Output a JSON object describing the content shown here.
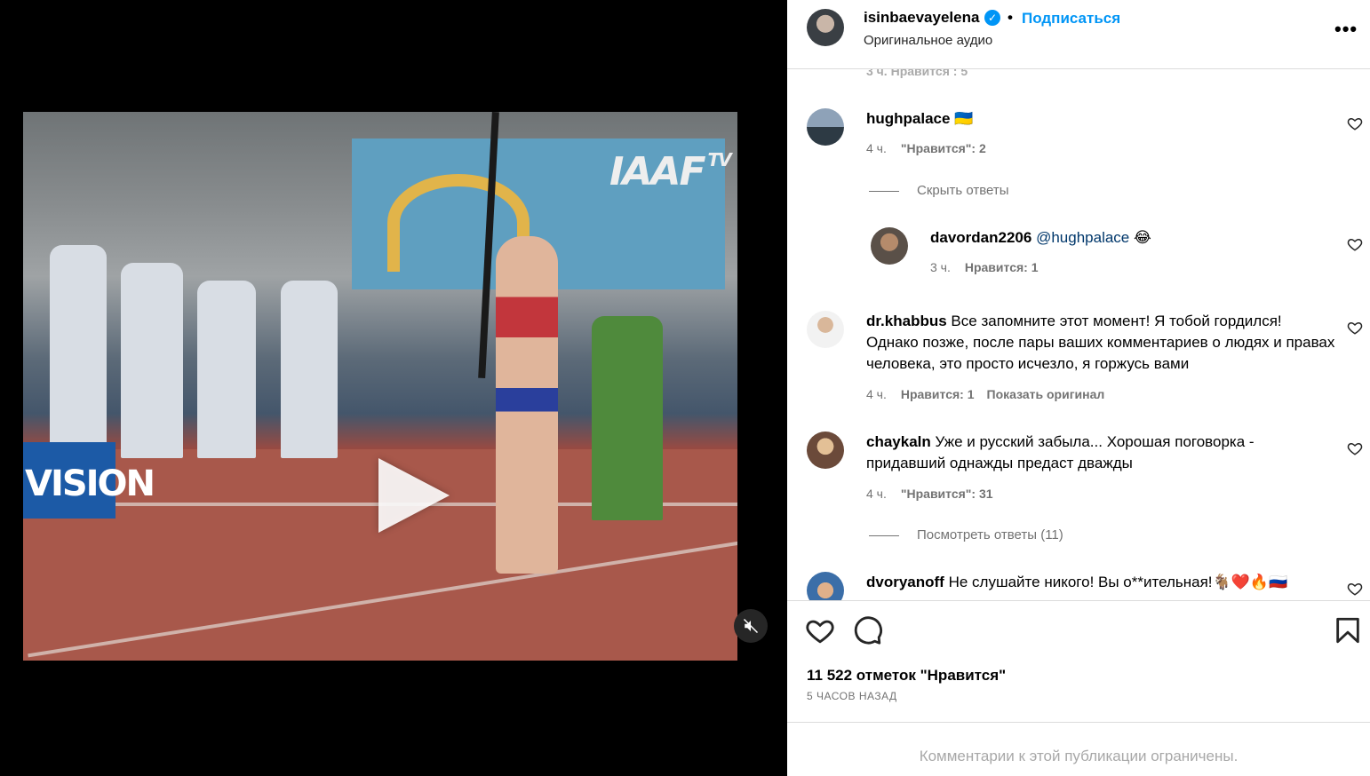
{
  "post": {
    "author": "isinbaevayelena",
    "follow_label": "Подписаться",
    "audio": "Оригинальное аудио",
    "more": "•••",
    "separator": "•"
  },
  "video": {
    "logo_text": "IAAF",
    "logo_suffix": "TV",
    "board_text": "VISION"
  },
  "comments": [
    {
      "cut_meta": "3 ч.    Нравится : 5"
    },
    {
      "user": "hughpalace",
      "text": "🇺🇦",
      "time": "4 ч.",
      "likes": "\"Нравится\": 2"
    },
    {
      "toggle": "Скрыть ответы"
    },
    {
      "user": "davordan2206",
      "mention": "@hughpalace",
      "text": "😂",
      "time": "3 ч.",
      "likes": "Нравится: 1"
    },
    {
      "user": "dr.khabbus",
      "text": "Все запомните этот момент! Я тобой гордился! Однако позже, после пары ваших комментариев о людях и правах человека, это просто исчезло, я горжусь вами",
      "time": "4 ч.",
      "likes": "Нравится: 1",
      "extra": "Показать оригинал"
    },
    {
      "user": "chaykaln",
      "text": "Уже и русский забыла... Хорошая поговорка - придавший однажды предаст дважды",
      "time": "4 ч.",
      "likes": "\"Нравится\": 31"
    },
    {
      "toggle": "Посмотреть ответы (11)"
    },
    {
      "user": "dvoryanoff",
      "text": "Не слушайте никого! Вы о**ительная!🐐❤️🔥🇷🇺"
    }
  ],
  "footer": {
    "likes": "11 522 отметок \"Нравится\"",
    "ago": "5 ЧАСОВ НАЗАД",
    "limited": "Комментарии к этой публикации ограничены."
  },
  "colors": {
    "accent": "#0095f6",
    "muted": "#737373",
    "mention": "#00376b"
  }
}
